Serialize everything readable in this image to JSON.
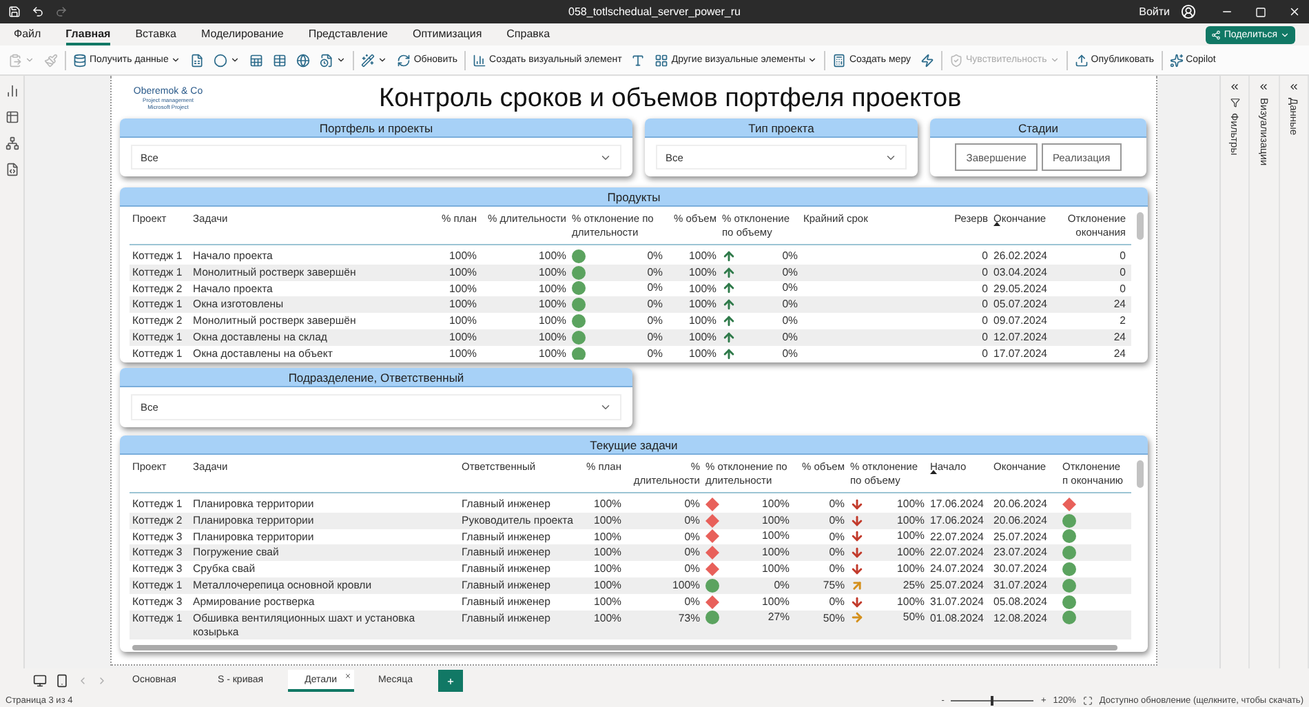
{
  "titlebar": {
    "filename": "058_totlschedual_server_power_ru",
    "signin": "Войти"
  },
  "menu": [
    {
      "label": "Файл",
      "selected": false
    },
    {
      "label": "Главная",
      "selected": true
    },
    {
      "label": "Вставка",
      "selected": false
    },
    {
      "label": "Моделирование",
      "selected": false
    },
    {
      "label": "Представление",
      "selected": false
    },
    {
      "label": "Оптимизация",
      "selected": false
    },
    {
      "label": "Справка",
      "selected": false
    }
  ],
  "share": "Поделиться",
  "toolbar": [
    {
      "kind": "icon",
      "disabled": true,
      "dropdown": true
    },
    {
      "kind": "icon",
      "disabled": true,
      "dropdown": false
    },
    {
      "kind": "separator"
    },
    {
      "kind": "labeled",
      "label": "Получить данные",
      "disabled": false,
      "dropdown": true
    },
    {
      "kind": "icon",
      "disabled": false,
      "dropdown": false
    },
    {
      "kind": "icon",
      "disabled": false,
      "dropdown": true
    },
    {
      "kind": "icon",
      "disabled": false,
      "dropdown": false
    },
    {
      "kind": "icon",
      "disabled": false,
      "dropdown": false
    },
    {
      "kind": "icon",
      "disabled": false,
      "dropdown": false
    },
    {
      "kind": "icon",
      "disabled": false,
      "dropdown": true
    },
    {
      "kind": "separator"
    },
    {
      "kind": "icon",
      "disabled": false,
      "dropdown": true
    },
    {
      "kind": "labeled",
      "label": "Обновить",
      "disabled": false,
      "dropdown": false
    },
    {
      "kind": "separator"
    },
    {
      "kind": "labeled",
      "label": "Создать визуальный элемент",
      "disabled": false,
      "dropdown": false
    },
    {
      "kind": "icon",
      "disabled": false,
      "dropdown": false
    },
    {
      "kind": "labeled",
      "label": "Другие визуальные элементы",
      "disabled": false,
      "dropdown": true
    },
    {
      "kind": "separator"
    },
    {
      "kind": "labeled",
      "label": "Создать меру",
      "disabled": false,
      "dropdown": false
    },
    {
      "kind": "icon",
      "disabled": false,
      "dropdown": false
    },
    {
      "kind": "separator"
    },
    {
      "kind": "labeled",
      "label": "Чувствительность",
      "disabled": true,
      "dropdown": true
    },
    {
      "kind": "separator"
    },
    {
      "kind": "labeled",
      "label": "Опубликовать",
      "disabled": false,
      "dropdown": false
    },
    {
      "kind": "separator"
    },
    {
      "kind": "labeled",
      "label": "Copilot",
      "disabled": false,
      "dropdown": false
    }
  ],
  "logo": {
    "name": "Oberemok & Co",
    "line_1": "Project management",
    "line_2": "Microsoft Project"
  },
  "report_title": "Контроль сроков и объемов портфеля проектов",
  "slicers": [
    {
      "title": "Портфель и проекты",
      "value": "Все"
    },
    {
      "title": "Тип проекта",
      "value": "Все"
    }
  ],
  "stages": {
    "title": "Стадии",
    "buttons": [
      {
        "label": "Завершение",
        "selected": false
      },
      {
        "label": "Реализация",
        "selected": false
      }
    ]
  },
  "products": {
    "title": "Продукты",
    "columns": [
      {
        "label": "Проект",
        "sorted": false
      },
      {
        "label": "Задачи",
        "sorted": false
      },
      {
        "label": "% план",
        "sorted": false
      },
      {
        "label": "% длительности",
        "sorted": false
      },
      {
        "label": "% отклонение по длительности",
        "sorted": false
      },
      {
        "label": "% объем",
        "sorted": false
      },
      {
        "label": "% отклонение по объему",
        "sorted": false
      },
      {
        "label": "Крайний срок",
        "sorted": false
      },
      {
        "label": "Резерв",
        "sorted": false
      },
      {
        "label": "Окончание",
        "sorted": true
      },
      {
        "label": "Отклонение окончания",
        "sorted": false
      }
    ],
    "rows": [
      [
        "Коттедж 1",
        "Начало проекта",
        "100%",
        "100%",
        {
          "kind": "circle",
          "text": "0%"
        },
        "100%",
        {
          "kind": "up",
          "text": "0%"
        },
        null,
        "0",
        "26.02.2024",
        "0"
      ],
      [
        "Коттедж 1",
        "Монолитный ростверк завершён",
        "100%",
        "100%",
        {
          "kind": "circle",
          "text": "0%"
        },
        "100%",
        {
          "kind": "up",
          "text": "0%"
        },
        null,
        "0",
        "03.04.2024",
        "0"
      ],
      [
        "Коттедж 2",
        "Начало проекта",
        "100%",
        "100%",
        {
          "kind": "circle",
          "text": "0%"
        },
        "100%",
        {
          "kind": "up",
          "text": "0%"
        },
        null,
        "0",
        "29.05.2024",
        "0"
      ],
      [
        "Коттедж 1",
        "Окна изготовлены",
        "100%",
        "100%",
        {
          "kind": "circle",
          "text": "0%"
        },
        "100%",
        {
          "kind": "up",
          "text": "0%"
        },
        null,
        "0",
        "05.07.2024",
        "24"
      ],
      [
        "Коттедж 2",
        "Монолитный ростверк завершён",
        "100%",
        "100%",
        {
          "kind": "circle",
          "text": "0%"
        },
        "100%",
        {
          "kind": "up",
          "text": "0%"
        },
        null,
        "0",
        "09.07.2024",
        "2"
      ],
      [
        "Коттедж 1",
        "Окна доставлены на склад",
        "100%",
        "100%",
        {
          "kind": "circle",
          "text": "0%"
        },
        "100%",
        {
          "kind": "up",
          "text": "0%"
        },
        null,
        "0",
        "12.07.2024",
        "24"
      ],
      [
        "Коттедж 1",
        "Окна доставлены на объект",
        "100%",
        "100%",
        {
          "kind": "circle",
          "text": "0%"
        },
        "100%",
        {
          "kind": "up",
          "text": "0%"
        },
        null,
        "0",
        "17.07.2024",
        "24"
      ]
    ]
  },
  "department_slicer": {
    "title": "Подразделение, Ответственный",
    "value": "Все"
  },
  "tasks": {
    "title": "Текущие задачи",
    "columns": [
      {
        "label": "Проект",
        "sorted": false
      },
      {
        "label": "Задачи",
        "sorted": false
      },
      {
        "label": "Ответственный",
        "sorted": false
      },
      {
        "label": "% план",
        "sorted": false
      },
      {
        "label": "% длительности",
        "sorted": false
      },
      {
        "label": "% отклонение по длительности",
        "sorted": false
      },
      {
        "label": "% объем",
        "sorted": false
      },
      {
        "label": "% отклонение по объему",
        "sorted": false
      },
      {
        "label": "Начало",
        "sorted": true
      },
      {
        "label": "Окончание",
        "sorted": false
      },
      {
        "label": "Отклонение п окончанию",
        "sorted": false
      }
    ],
    "rows": [
      [
        "Коттедж 1",
        "Планировка территории",
        "Главный инженер",
        "100%",
        "0%",
        {
          "kind": "diamond",
          "text": "100%"
        },
        "0%",
        {
          "kind": "down",
          "text": "100%"
        },
        "17.06.2024",
        "20.06.2024",
        {
          "kind": "diamond"
        }
      ],
      [
        "Коттедж 2",
        "Планировка территории",
        "Руководитель проекта",
        "100%",
        "0%",
        {
          "kind": "diamond",
          "text": "100%"
        },
        "0%",
        {
          "kind": "down",
          "text": "100%"
        },
        "17.06.2024",
        "20.06.2024",
        {
          "kind": "circle"
        }
      ],
      [
        "Коттедж 3",
        "Планировка территории",
        "Главный инженер",
        "100%",
        "0%",
        {
          "kind": "diamond",
          "text": "100%"
        },
        "0%",
        {
          "kind": "down",
          "text": "100%"
        },
        "22.07.2024",
        "25.07.2024",
        {
          "kind": "circle"
        }
      ],
      [
        "Коттедж 3",
        "Погружение свай",
        "Главный инженер",
        "100%",
        "0%",
        {
          "kind": "diamond",
          "text": "100%"
        },
        "0%",
        {
          "kind": "down",
          "text": "100%"
        },
        "22.07.2024",
        "23.07.2024",
        {
          "kind": "circle"
        }
      ],
      [
        "Коттедж 3",
        "Срубка свай",
        "Главный инженер",
        "100%",
        "0%",
        {
          "kind": "diamond",
          "text": "100%"
        },
        "0%",
        {
          "kind": "down",
          "text": "100%"
        },
        "24.07.2024",
        "30.07.2024",
        {
          "kind": "circle"
        }
      ],
      [
        "Коттедж 1",
        "Металлочерепица основной кровли",
        "Главный инженер",
        "100%",
        "100%",
        {
          "kind": "circle",
          "text": "0%"
        },
        "75%",
        {
          "kind": "upright",
          "text": "25%"
        },
        "25.07.2024",
        "31.07.2024",
        {
          "kind": "circle"
        }
      ],
      [
        "Коттедж 3",
        "Армирование ростверка",
        "Главный инженер",
        "100%",
        "0%",
        {
          "kind": "diamond",
          "text": "100%"
        },
        "0%",
        {
          "kind": "down",
          "text": "100%"
        },
        "31.07.2024",
        "05.08.2024",
        {
          "kind": "circle"
        }
      ],
      [
        "Коттедж 1",
        "Обшивка вентиляционных шахт и установка козырька",
        "Главный инженер",
        "100%",
        "73%",
        {
          "kind": "circle",
          "text": "27%"
        },
        "50%",
        {
          "kind": "right",
          "text": "50%"
        },
        "01.08.2024",
        "12.08.2024",
        {
          "kind": "circle"
        }
      ]
    ]
  },
  "panes": [
    {
      "label": "Фильтры"
    },
    {
      "label": "Визуализации"
    },
    {
      "label": "Данные"
    }
  ],
  "pages": [
    {
      "label": "Основная",
      "selected": false
    },
    {
      "label": "S - кривая",
      "selected": false
    },
    {
      "label": "Детали",
      "selected": true
    },
    {
      "label": "Месяца",
      "selected": false
    }
  ],
  "status": {
    "page": "Страница 3 из 4",
    "zoom_minus": "-",
    "zoom_plus": "+",
    "zoom_slider": {
      "level": 0.5
    },
    "zoom": "120%",
    "update": "Доступно обновление (щелкните, чтобы скачать)"
  }
}
